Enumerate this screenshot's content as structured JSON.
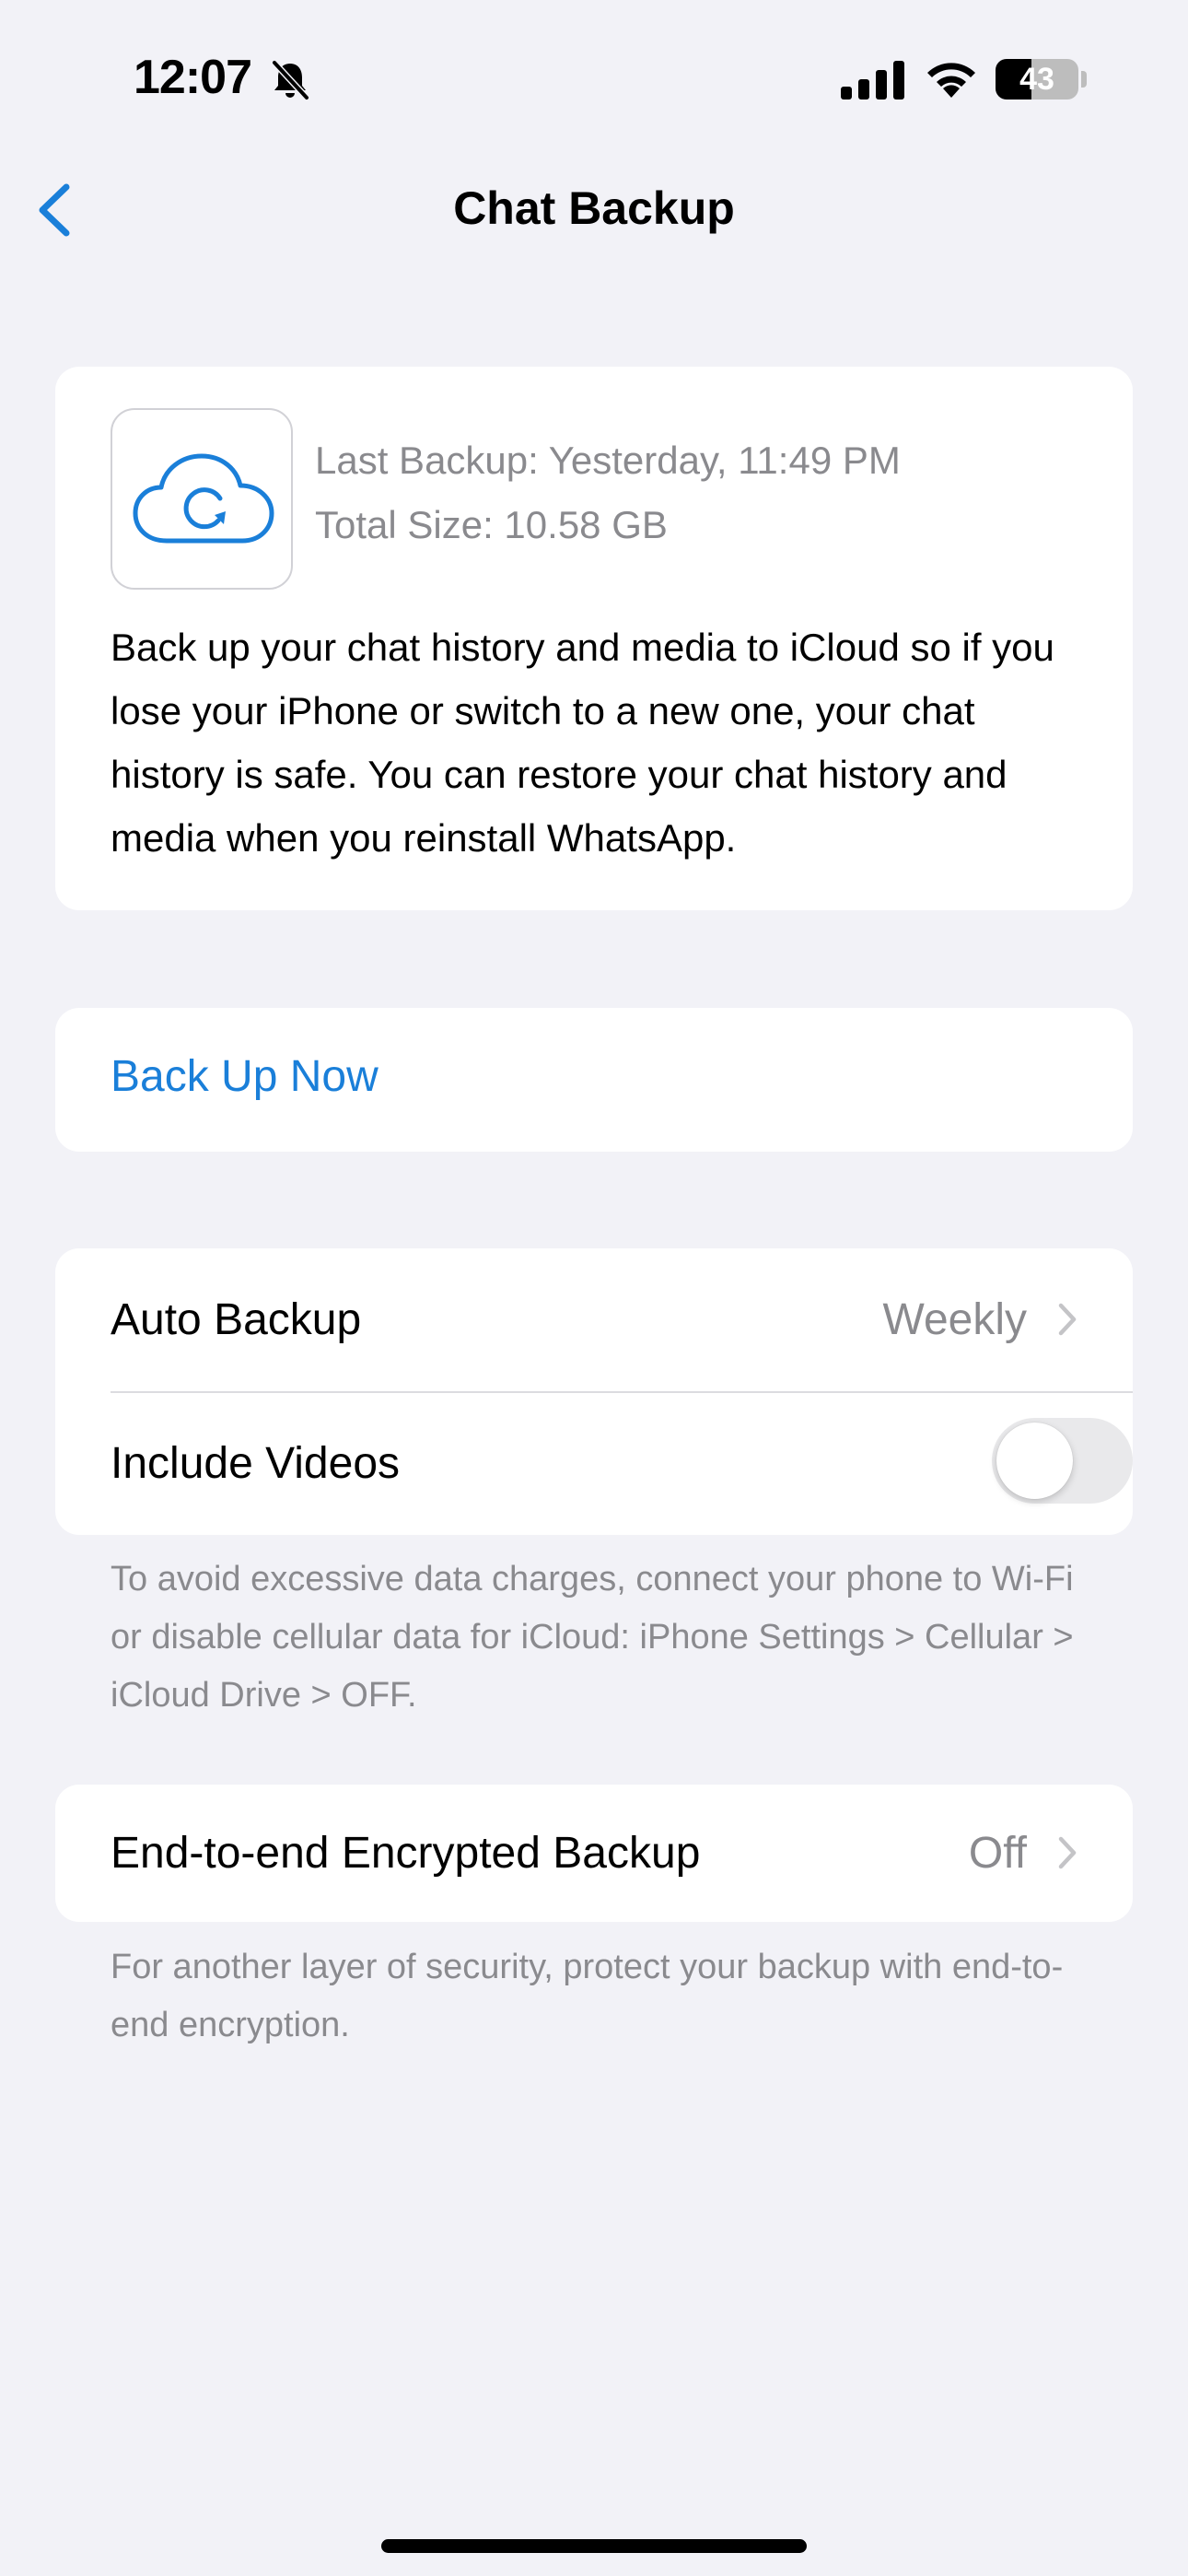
{
  "status_bar": {
    "time": "12:07",
    "battery_level": "43",
    "battery_fraction": 0.43,
    "icons": [
      "bell-slash-icon",
      "cellular-signal-icon",
      "wifi-icon",
      "battery-icon"
    ]
  },
  "nav": {
    "title": "Chat Backup",
    "back_icon": "chevron-left-icon"
  },
  "backup_info": {
    "icon": "icloud-sync-icon",
    "last_backup": "Last Backup: Yesterday, 11:49 PM",
    "total_size": "Total Size: 10.58 GB",
    "description": "Back up your chat history and media to iCloud so if you lose your iPhone or switch to a new one, your chat history is safe. You can restore your chat history and media when you reinstall WhatsApp."
  },
  "actions": {
    "back_up_now": "Back Up Now"
  },
  "settings": {
    "auto_backup_label": "Auto Backup",
    "auto_backup_value": "Weekly",
    "include_videos_label": "Include Videos",
    "include_videos_on": false,
    "data_note": "To avoid excessive data charges, connect your phone to Wi-Fi or disable cellular data for iCloud: iPhone Settings > Cellular > iCloud Drive > OFF."
  },
  "encryption": {
    "label": "End-to-end Encrypted Backup",
    "value": "Off",
    "note": "For another layer of security, protect your backup with end-to-end encryption."
  },
  "colors": {
    "accent": "#1a7fd9",
    "background": "#f2f2f7",
    "secondary_text": "#8a8a8e",
    "toggle_off": "#e9e9eb"
  }
}
